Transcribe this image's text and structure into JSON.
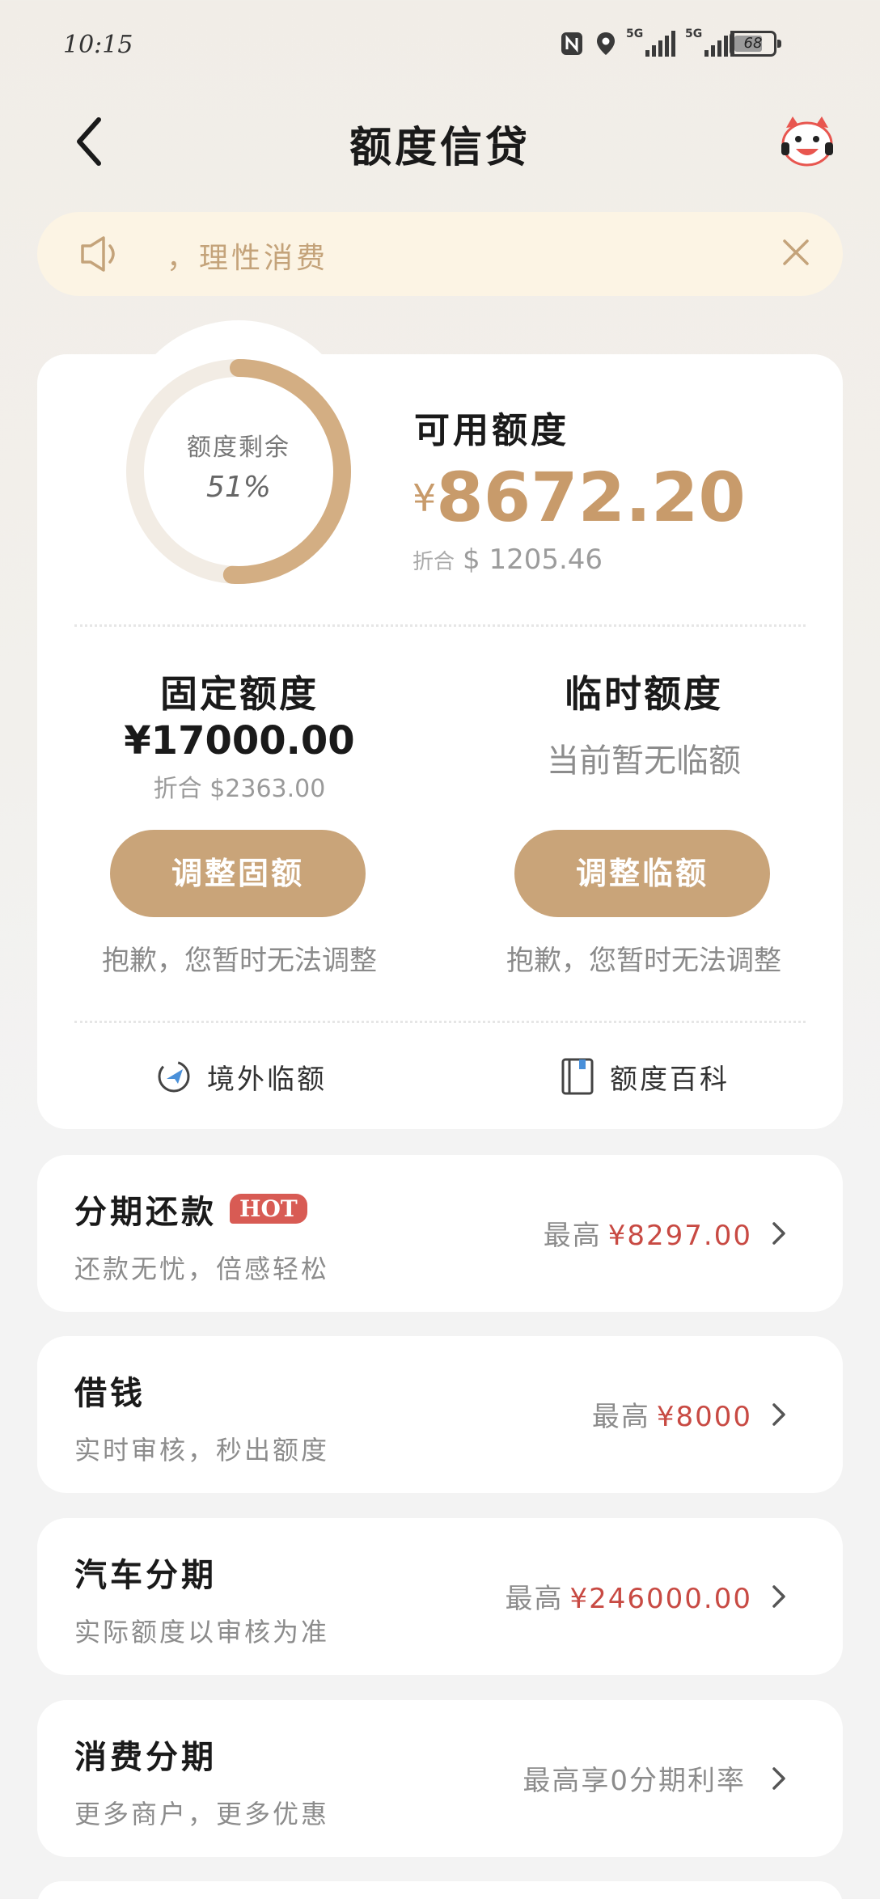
{
  "status_bar": {
    "time": "10:15",
    "signal1_label": "5G",
    "signal2_label": "5G",
    "battery": "68",
    "icons": [
      "nfc-icon",
      "location-icon",
      "signal-icon",
      "signal-icon",
      "battery-icon"
    ]
  },
  "header": {
    "title": "额度信贷",
    "back_icon": "chevron-left-icon",
    "mascot_icon": "mascot-icon"
  },
  "notice": {
    "text": "，理性消费",
    "icon": "speaker-icon",
    "close_icon": "close-icon"
  },
  "credit": {
    "ring_label": "额度剩余",
    "ring_percent_text": "51%",
    "ring_fraction": 0.51,
    "available_label": "可用额度",
    "available_currency": "¥",
    "available_amount": "8672.20",
    "conversion_prefix": "折合",
    "conversion_value": "$ 1205.46"
  },
  "fixed_quota": {
    "title": "固定额度",
    "amount": "¥17000.00",
    "conversion": "折合 $2363.00",
    "button": "调整固额",
    "note": "抱歉，您暂时无法调整"
  },
  "temp_quota": {
    "title": "临时额度",
    "status": "当前暂无临额",
    "button": "调整临额",
    "note": "抱歉，您暂时无法调整"
  },
  "links": [
    {
      "label": "境外临额",
      "icon": "plane-icon"
    },
    {
      "label": "额度百科",
      "icon": "book-icon"
    }
  ],
  "products": [
    {
      "name": "分期还款",
      "badge": "HOT",
      "sub": "还款无忧，倍感轻松",
      "prefix": "最高",
      "value": "¥8297.00"
    },
    {
      "name": "借钱",
      "sub": "实时审核，秒出额度",
      "prefix": "最高",
      "value": "¥8000"
    },
    {
      "name": "汽车分期",
      "sub": "实际额度以审核为准",
      "prefix": "最高",
      "value": "¥246000.00"
    },
    {
      "name": "消费分期",
      "sub": "更多商户，更多优惠",
      "prefix": "最高享0分期利率",
      "value": ""
    }
  ],
  "colors": {
    "accent": "#c9a479",
    "accent_text": "#c89b6b",
    "price_red": "#c84a43",
    "notice_bg": "#fcf4e4",
    "hot_badge": "#d85b54"
  }
}
